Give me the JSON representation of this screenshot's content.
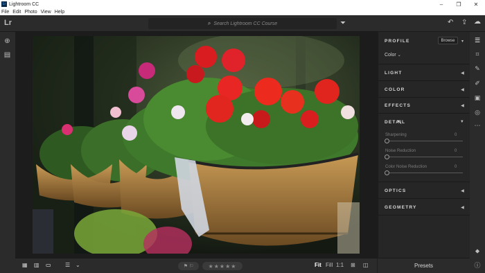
{
  "window": {
    "title": "Lightroom CC",
    "minimize": "–",
    "maximize": "❐",
    "close": "✕"
  },
  "menu": [
    "File",
    "Edit",
    "Photo",
    "View",
    "Help"
  ],
  "topbar": {
    "logo": "Lr",
    "search_placeholder": "Search Lightroom CC Course"
  },
  "bottom": {
    "zoom_fit": "Fit",
    "zoom_fill": "Fill",
    "zoom_1to1": "1:1",
    "stars": "★★★★★"
  },
  "panel": {
    "profile_label": "PROFILE",
    "browse": "Browse",
    "profile_value": "Color",
    "sections": {
      "light": "LIGHT",
      "color": "COLOR",
      "effects": "EFFECTS",
      "detail": "DETAIL",
      "optics": "OPTICS",
      "geometry": "GEOMETRY"
    },
    "detail_sliders": [
      {
        "label": "Sharpening",
        "value": "0"
      },
      {
        "label": "Noise Reduction",
        "value": "0"
      },
      {
        "label": "Color Noise Reduction",
        "value": "0"
      }
    ],
    "footer": "Presets"
  },
  "colors": {
    "panel_bg": "#262626",
    "bar_bg": "#2b2b2b",
    "accent": "#ffffff"
  }
}
